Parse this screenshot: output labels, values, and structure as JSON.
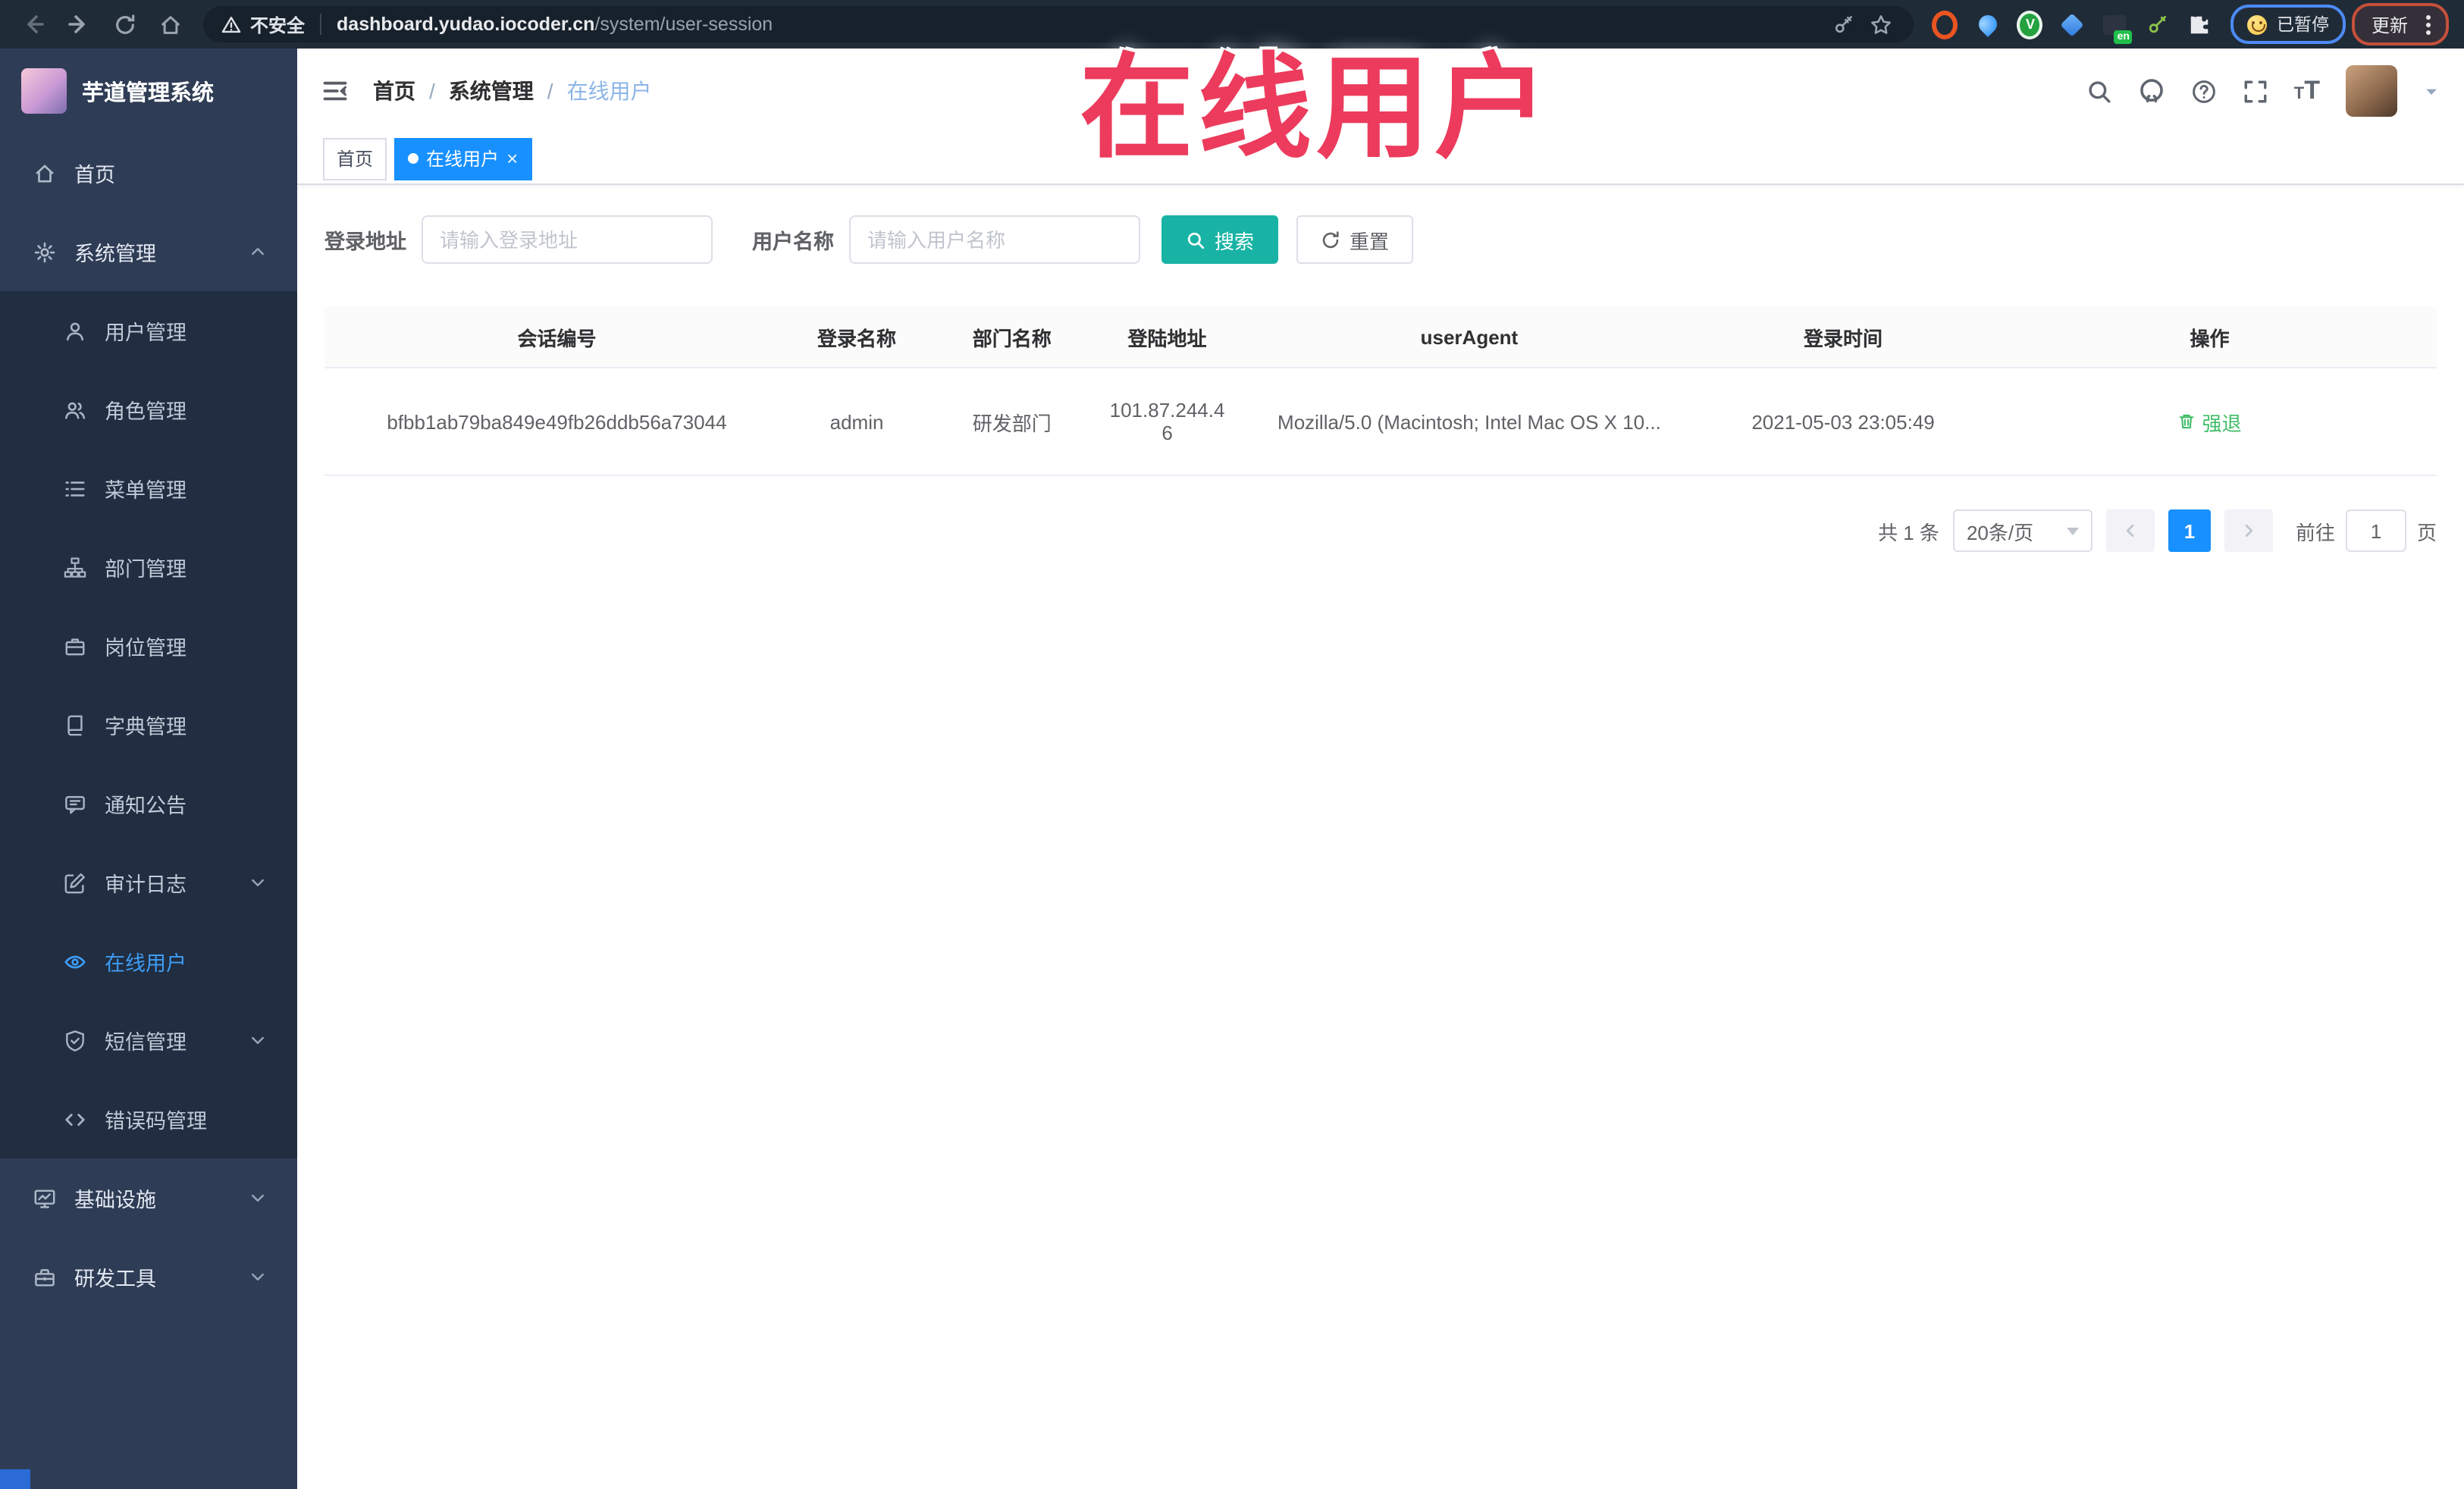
{
  "browser": {
    "security_label": "不安全",
    "url_domain": "dashboard.yudao.iocoder.cn",
    "url_path": "/system/user-session",
    "ext_badge": "en",
    "paused_label": "已暂停",
    "update_label": "更新"
  },
  "overlay": {
    "title": "在线用户"
  },
  "sidebar": {
    "title": "芋道管理系统",
    "items": [
      {
        "label": "首页"
      },
      {
        "label": "系统管理"
      },
      {
        "label": "用户管理"
      },
      {
        "label": "角色管理"
      },
      {
        "label": "菜单管理"
      },
      {
        "label": "部门管理"
      },
      {
        "label": "岗位管理"
      },
      {
        "label": "字典管理"
      },
      {
        "label": "通知公告"
      },
      {
        "label": "审计日志"
      },
      {
        "label": "在线用户",
        "active": true
      },
      {
        "label": "短信管理"
      },
      {
        "label": "错误码管理"
      },
      {
        "label": "基础设施"
      },
      {
        "label": "研发工具"
      }
    ]
  },
  "nav": {
    "breadcrumb": [
      "首页",
      "系统管理",
      "在线用户"
    ]
  },
  "tags": {
    "items": [
      {
        "label": "首页"
      },
      {
        "label": "在线用户",
        "active": true
      }
    ]
  },
  "filters": {
    "login_address_label": "登录地址",
    "login_address_placeholder": "请输入登录地址",
    "username_label": "用户名称",
    "username_placeholder": "请输入用户名称",
    "search_label": "搜索",
    "reset_label": "重置"
  },
  "table": {
    "headers": [
      "会话编号",
      "登录名称",
      "部门名称",
      "登陆地址",
      "userAgent",
      "登录时间",
      "操作"
    ],
    "row": {
      "session_id": "bfbb1ab79ba849e49fb26ddb56a73044",
      "login_name": "admin",
      "dept_name": "研发部门",
      "login_ip": "101.87.244.46",
      "user_agent": "Mozilla/5.0 (Macintosh; Intel Mac OS X 10...",
      "login_time": "2021-05-03 23:05:49",
      "action_label": "强退"
    }
  },
  "pagination": {
    "total_label": "共 1 条",
    "page_size_label": "20条/页",
    "current_page": "1",
    "goto_label": "前往",
    "goto_value": "1",
    "goto_suffix": "页"
  },
  "colors": {
    "accent_blue": "#1890ff",
    "search_teal": "#18b3a4",
    "action_green": "#3fbd67",
    "annotation_red": "#ec3b5c",
    "sidebar_bg": "#2e3c55",
    "submenu_bg": "#212d40"
  }
}
